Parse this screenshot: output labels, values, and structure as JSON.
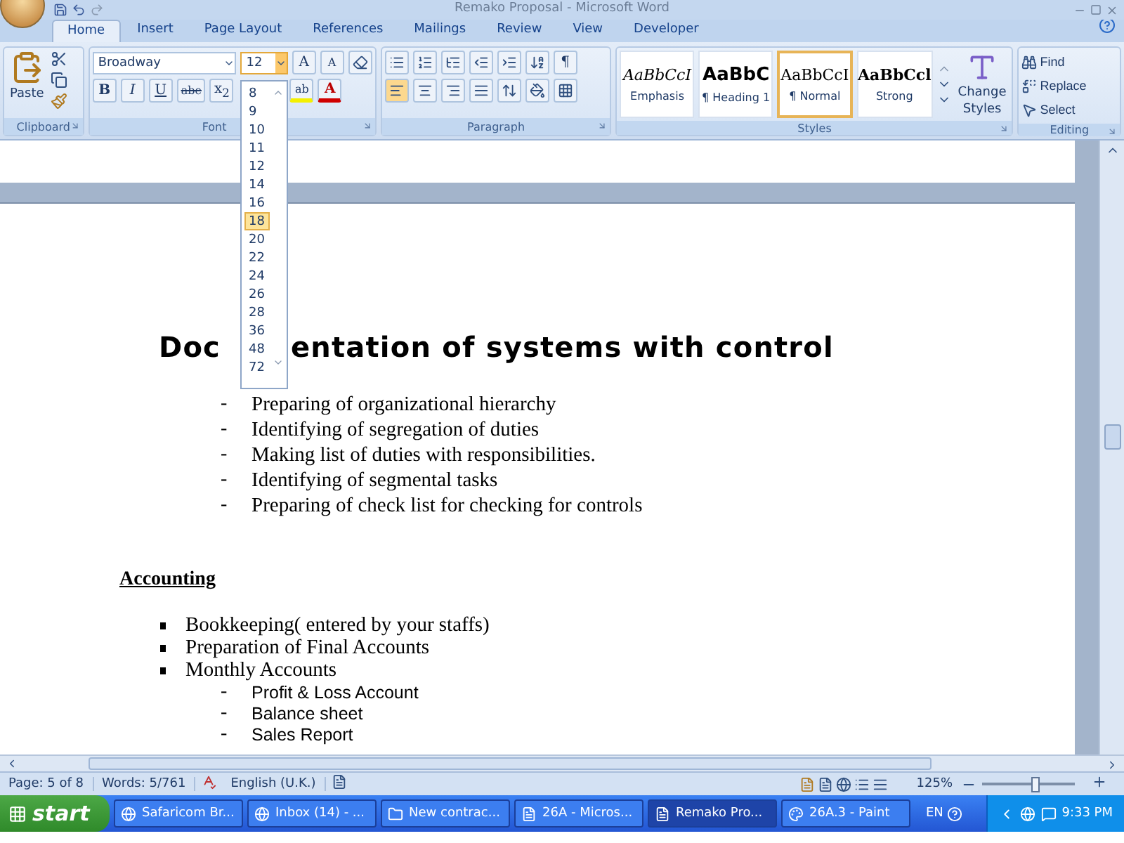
{
  "window": {
    "title": "Remako Proposal - Microsoft Word"
  },
  "tabs": [
    {
      "label": "Home",
      "selected": true
    },
    {
      "label": "Insert",
      "selected": false
    },
    {
      "label": "Page Layout",
      "selected": false
    },
    {
      "label": "References",
      "selected": false
    },
    {
      "label": "Mailings",
      "selected": false
    },
    {
      "label": "Review",
      "selected": false
    },
    {
      "label": "View",
      "selected": false
    },
    {
      "label": "Developer",
      "selected": false
    }
  ],
  "clipboard": {
    "paste": "Paste",
    "group": "Clipboard"
  },
  "font": {
    "name": "Broadway",
    "size": "12",
    "group": "Font",
    "grow": "A",
    "shrink": "A",
    "bold": "B",
    "italic": "I",
    "underline": "U",
    "strike": "abe",
    "subscript": "x$_{2}$",
    "highlight": "ab",
    "font_color_letter": "A"
  },
  "paragraph": {
    "group": "Paragraph",
    "pilcrow": "¶",
    "align": [
      {
        "kind": "left",
        "selected": true
      },
      {
        "kind": "center",
        "selected": false
      },
      {
        "kind": "right",
        "selected": false
      },
      {
        "kind": "justify",
        "selected": false
      }
    ]
  },
  "styles": {
    "group": "Styles",
    "items": [
      {
        "kind": "emphasis",
        "preview": "AaBbCcI",
        "label": "Emphasis",
        "selected": false
      },
      {
        "kind": "heading",
        "preview": "AaBbC",
        "label": "¶ Heading 1",
        "selected": false
      },
      {
        "kind": "normal",
        "preview": "AaBbCcI",
        "label": "¶ Normal",
        "selected": true
      },
      {
        "kind": "strong",
        "preview": "AaBbCcl",
        "label": "Strong",
        "selected": false
      }
    ],
    "change": [
      "Change",
      "Styles"
    ]
  },
  "editing": {
    "group": "Editing",
    "find": "Find",
    "replace": "Replace",
    "select": "Select"
  },
  "size_dropdown": [
    {
      "label": "8",
      "selected": false
    },
    {
      "label": "9",
      "selected": false
    },
    {
      "label": "10",
      "selected": false
    },
    {
      "label": "11",
      "selected": false
    },
    {
      "label": "12",
      "selected": false
    },
    {
      "label": "14",
      "selected": false
    },
    {
      "label": "16",
      "selected": false
    },
    {
      "label": "18",
      "selected": true
    },
    {
      "label": "20",
      "selected": false
    },
    {
      "label": "22",
      "selected": false
    },
    {
      "label": "24",
      "selected": false
    },
    {
      "label": "26",
      "selected": false
    },
    {
      "label": "28",
      "selected": false
    },
    {
      "label": "36",
      "selected": false
    },
    {
      "label": "48",
      "selected": false
    },
    {
      "label": "72",
      "selected": false
    }
  ],
  "document": {
    "heading_visible_parts": [
      "Doc",
      "entation of systems with control"
    ],
    "dash_list": [
      {
        "marker": "-",
        "text": "Preparing of organizational hierarchy"
      },
      {
        "marker": "-",
        "text": "Identifying of segregation of duties"
      },
      {
        "marker": "-",
        "text": "Making list of duties with responsibilities."
      },
      {
        "marker": "-",
        "text": "Identifying of  segmental tasks"
      },
      {
        "marker": "-",
        "text": "Preparing of check list for checking for controls"
      }
    ],
    "section": "Accounting",
    "bullets": [
      "Bookkeeping( entered by your staffs)",
      "Preparation of Final Accounts",
      "Monthly Accounts"
    ],
    "sub_list": [
      {
        "marker": "-",
        "text": "Profit & Loss Account"
      },
      {
        "marker": "-",
        "text": "Balance sheet"
      },
      {
        "marker": "-",
        "text": "Sales Report"
      }
    ]
  },
  "status_bar": {
    "page": "Page: 5 of 8",
    "words": "Words: 5/761",
    "language": "English (U.K.)",
    "zoom": "125%",
    "zoom_level": {
      "level": 0.58
    }
  },
  "taskbar": {
    "start": "start",
    "items": [
      {
        "label": "Safaricom Br...",
        "kind": "browser",
        "selected": false
      },
      {
        "label": "Inbox (14) - ...",
        "kind": "chrome",
        "selected": false
      },
      {
        "label": "New contrac...",
        "kind": "folder",
        "selected": false
      },
      {
        "label": "26A - Micros...",
        "kind": "word",
        "selected": false
      },
      {
        "label": "Remako Pro...",
        "kind": "word",
        "selected": true
      },
      {
        "label": "26A.3 - Paint",
        "kind": "paint",
        "selected": false
      }
    ],
    "lang": "EN",
    "clock": "9:33 PM"
  }
}
